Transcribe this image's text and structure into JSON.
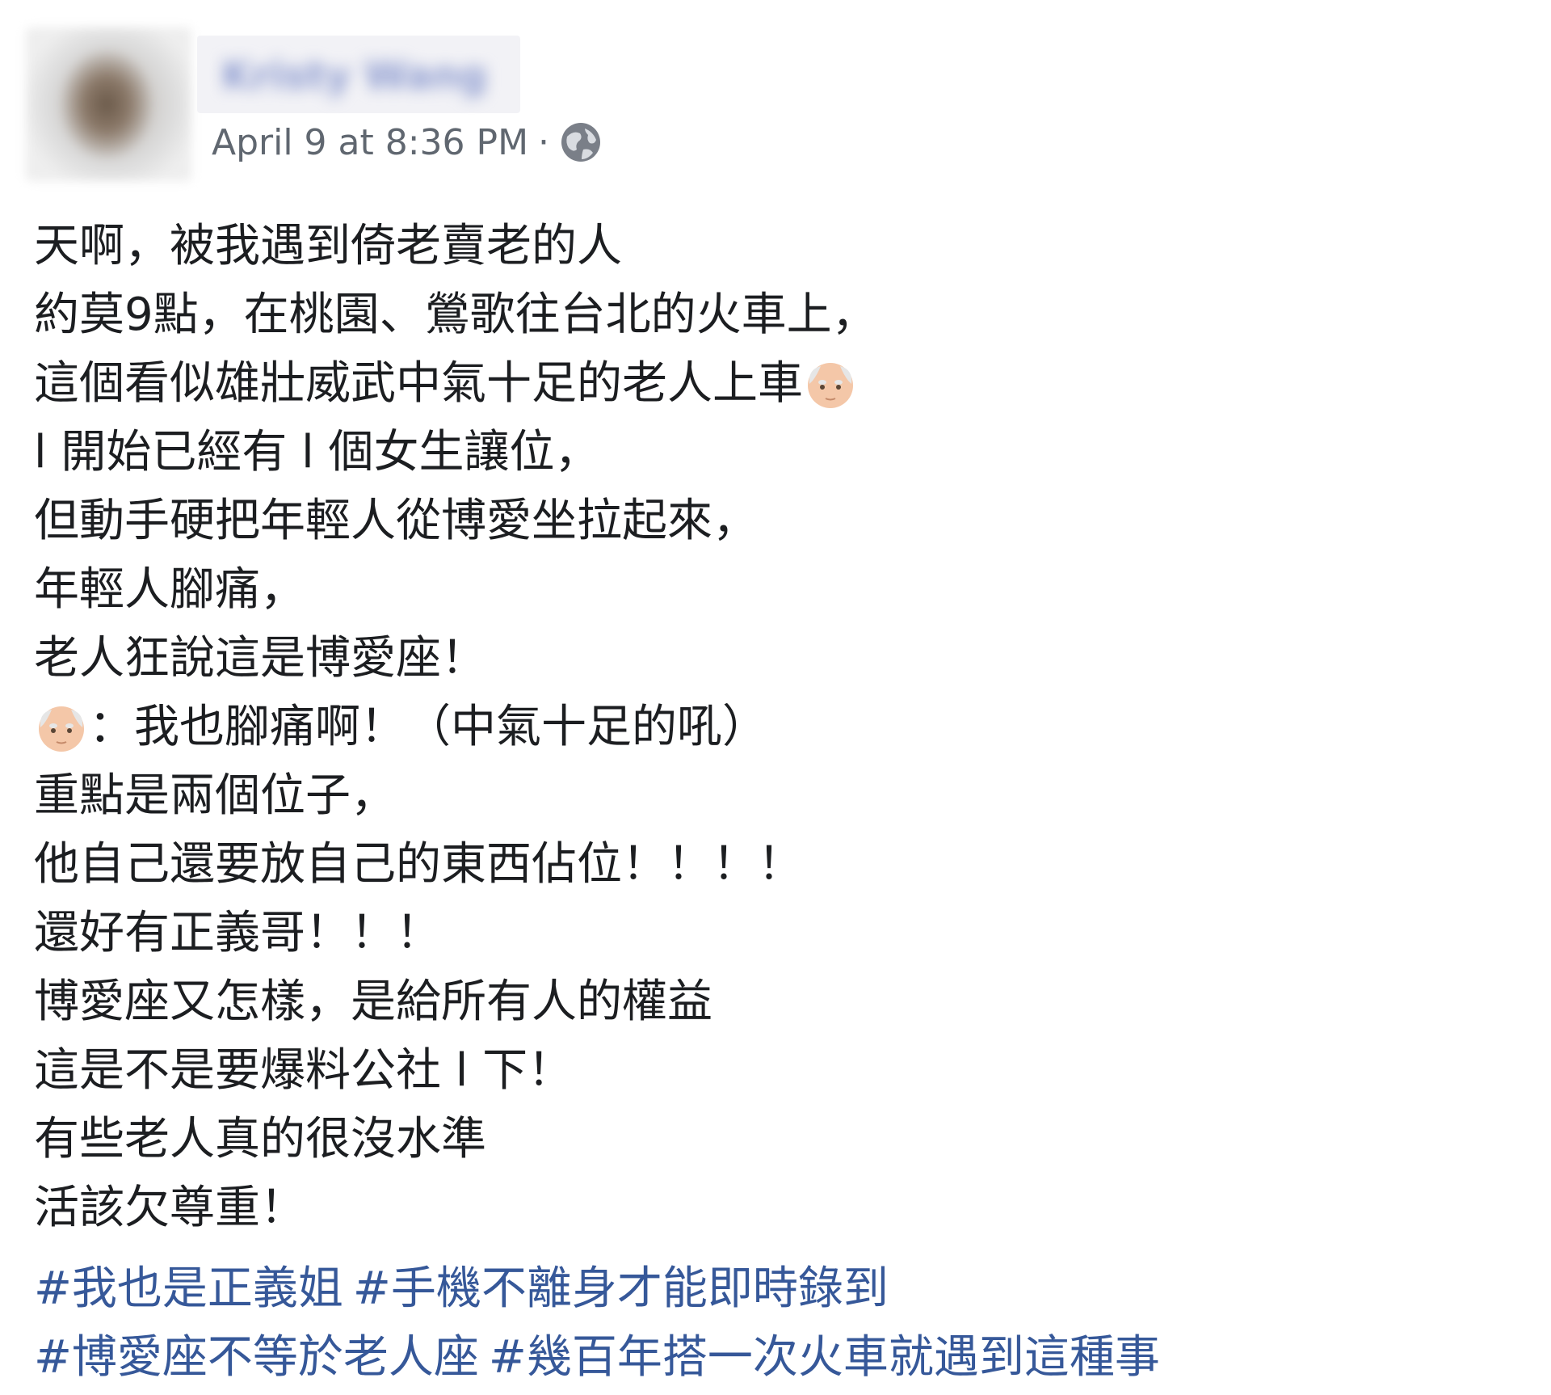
{
  "author": {
    "name": "Kristy Wang"
  },
  "timestamp": "April 9 at 8:36 PM",
  "separator": "·",
  "privacy_icon": "globe-icon",
  "post_lines": [
    "天啊，被我遇到倚老賣老的人",
    "約莫9點，在桃園、鶯歌往台北的火車上，",
    "這個看似雄壯威武中氣十足的老人上車",
    "l 開始已經有 l 個女生讓位，",
    "但動手硬把年輕人從博愛坐拉起來，",
    "年輕人腳痛，",
    "老人狂說這是博愛座！",
    "：我也腳痛啊！（中氣十足的吼）",
    "重點是兩個位子，",
    "他自己還要放自己的東西佔位！！！！",
    "還好有正義哥！！！",
    "博愛座又怎樣，是給所有人的權益",
    "這是不是要爆料公社 l 下！",
    "有些老人真的很沒水準",
    "活該欠尊重！"
  ],
  "emoji": "older-man-emoji",
  "hashtags": [
    [
      "#我也是正義姐",
      "#手機不離身才能即時錄到"
    ],
    [
      "#博愛座不等於老人座",
      "#幾百年搭一次火車就遇到這種事"
    ]
  ],
  "colors": {
    "text": "#1c1e21",
    "meta": "#606770",
    "hashtag": "#365899"
  }
}
